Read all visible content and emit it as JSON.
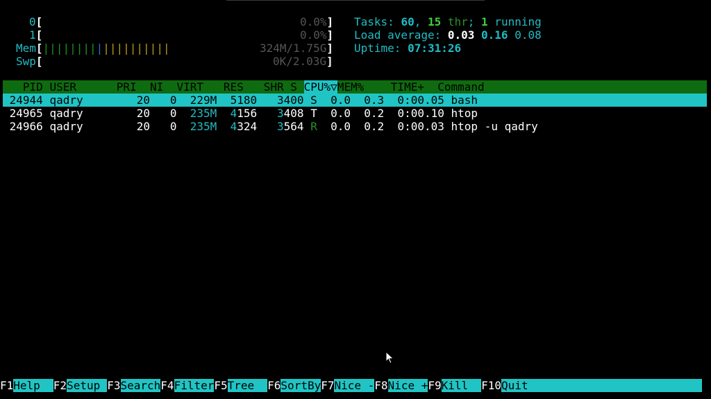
{
  "meters": {
    "cpu0": {
      "label": "0",
      "value": "0.0%"
    },
    "cpu1": {
      "label": "1",
      "value": "0.0%"
    },
    "mem": {
      "label": "Mem",
      "bars_green": "||||||||",
      "bars_blue": "|",
      "bars_yellow": "||||||||||",
      "value": "324M/1.75G"
    },
    "swp": {
      "label": "Swp",
      "value": "0K/2.03G"
    }
  },
  "tasks": {
    "label": "Tasks: ",
    "count": "60",
    "sep": ", ",
    "threads": "15",
    "thr_label": " thr",
    "semicolon": "; ",
    "running": "1",
    "running_label": " running"
  },
  "load": {
    "label": "Load average: ",
    "one": "0.03",
    "five": "0.16",
    "fifteen": "0.08"
  },
  "uptime": {
    "label": "Uptime: ",
    "value": "07:31:26"
  },
  "columns": {
    "pid": "PID",
    "user": "USER",
    "pri": "PRI",
    "ni": "NI",
    "virt": "VIRT",
    "res": "RES",
    "shr": "SHR",
    "s": "S",
    "cpu": "CPU%▽",
    "mem": "MEM%",
    "time": "TIME+",
    "command": "Command"
  },
  "processes": [
    {
      "pid": "24944",
      "user": "qadry",
      "pri": "20",
      "ni": "0",
      "virt": "229M",
      "res": "5180",
      "shr": "3400",
      "s": "S",
      "cpu": "0.0",
      "mem": "0.3",
      "time": "0:00.05",
      "command": "bash"
    },
    {
      "pid": "24965",
      "user": "qadry",
      "pri": "20",
      "ni": "0",
      "virt_hi": "235M",
      "res_hi": "4",
      "res_lo": "156",
      "shr_hi": "3",
      "shr_lo": "408",
      "s": "T",
      "cpu": "0.0",
      "mem": "0.2",
      "time": "0:00.10",
      "command": "htop"
    },
    {
      "pid": "24966",
      "user": "qadry",
      "pri": "20",
      "ni": "0",
      "virt_hi": "235M",
      "res_hi": "4",
      "res_lo": "324",
      "shr_hi": "3",
      "shr_lo": "564",
      "s": "R",
      "cpu": "0.0",
      "mem": "0.2",
      "time": "0:00.03",
      "command": "htop -u qadry"
    }
  ],
  "footer": [
    {
      "key": "F1",
      "label": "Help"
    },
    {
      "key": "F2",
      "label": "Setup"
    },
    {
      "key": "F3",
      "label": "Search"
    },
    {
      "key": "F4",
      "label": "Filter"
    },
    {
      "key": "F5",
      "label": "Tree"
    },
    {
      "key": "F6",
      "label": "SortBy"
    },
    {
      "key": "F7",
      "label": "Nice -"
    },
    {
      "key": "F8",
      "label": "Nice +"
    },
    {
      "key": "F9",
      "label": "Kill"
    },
    {
      "key": "F10",
      "label": "Quit"
    }
  ]
}
